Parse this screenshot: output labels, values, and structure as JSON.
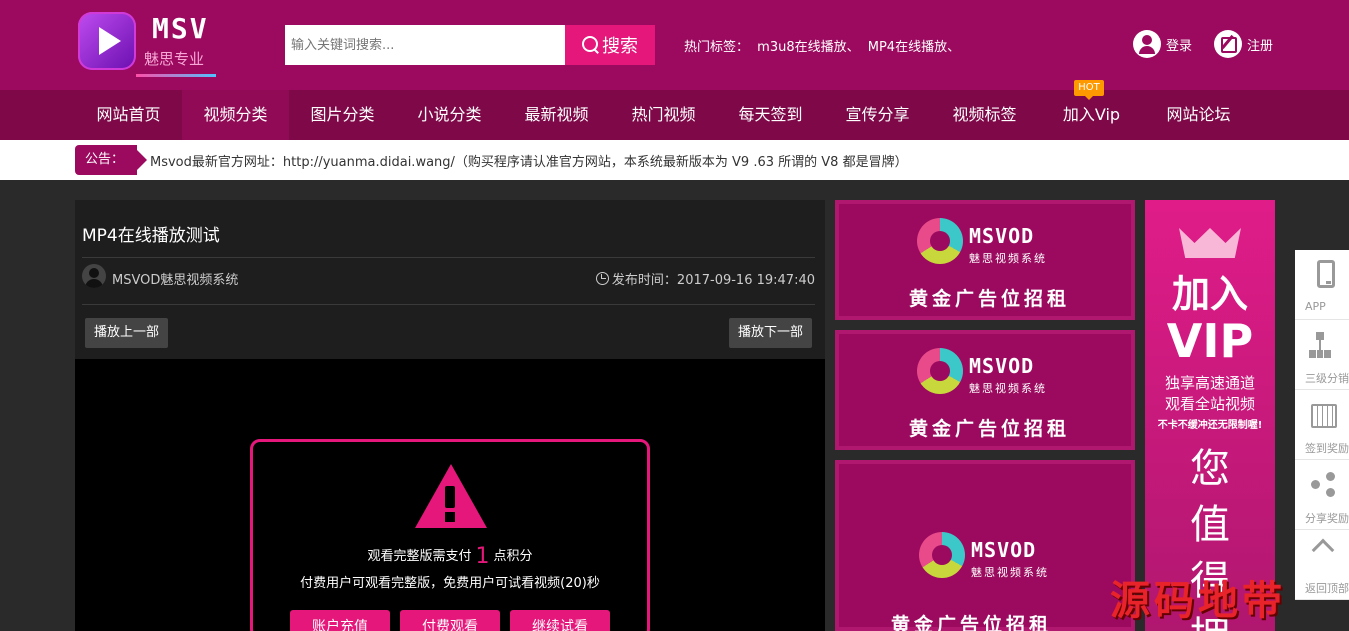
{
  "header": {
    "logo_text": "MSV",
    "logo_sub": "魅思专业",
    "search_placeholder": "输入关键词搜索...",
    "search_button": "搜索",
    "hot_tags_label": "热门标签：",
    "hot_tags": [
      "m3u8在线播放、",
      "MP4在线播放、"
    ],
    "login": "登录",
    "register": "注册"
  },
  "nav": {
    "items": [
      "网站首页",
      "视频分类",
      "图片分类",
      "小说分类",
      "最新视频",
      "热门视频",
      "每天签到",
      "宣传分享",
      "视频标签",
      "加入Vip",
      "网站论坛"
    ],
    "active_index": 1,
    "hot_badge": "HOT"
  },
  "notice": {
    "label": "公告：",
    "text": "Msvod最新官方网址：http://yuanma.didai.wang/（购买程序请认准官方网站，本系统最新版本为 V9 .63 所谓的 V8 都是冒牌）"
  },
  "video": {
    "title": "MP4在线播放测试",
    "author": "MSVOD魅思视频系统",
    "publish": "发布时间：2017-09-16 19:47:40",
    "prev": "播放上一部",
    "next": "播放下一部"
  },
  "paywall": {
    "line1_pre": "观看完整版需支付",
    "points": "1",
    "line1_post": "点积分",
    "line2": "付费用户可观看完整版，免费用户可试看视频(20)秒",
    "buttons": [
      "账户充值",
      "付费观看",
      "继续试看"
    ]
  },
  "ads": {
    "brand": "MSVOD",
    "brand_sub": "魅思视频系统",
    "text": "黄金广告位招租"
  },
  "vip": {
    "join": "加入",
    "big": "VIP",
    "line1": "独享高速通道",
    "line2": "观看全站视频",
    "line3": "不卡不缓冲还无限制喔!",
    "chars": [
      "您",
      "值",
      "得",
      "拥"
    ]
  },
  "side": {
    "items": [
      "APP",
      "三级分销",
      "签到奖励",
      "分享奖励",
      "返回顶部"
    ]
  },
  "watermark": "源码地带",
  "colors": {
    "brand": "#9b0a5e",
    "accent": "#e5177a",
    "nav": "#7e0848"
  }
}
